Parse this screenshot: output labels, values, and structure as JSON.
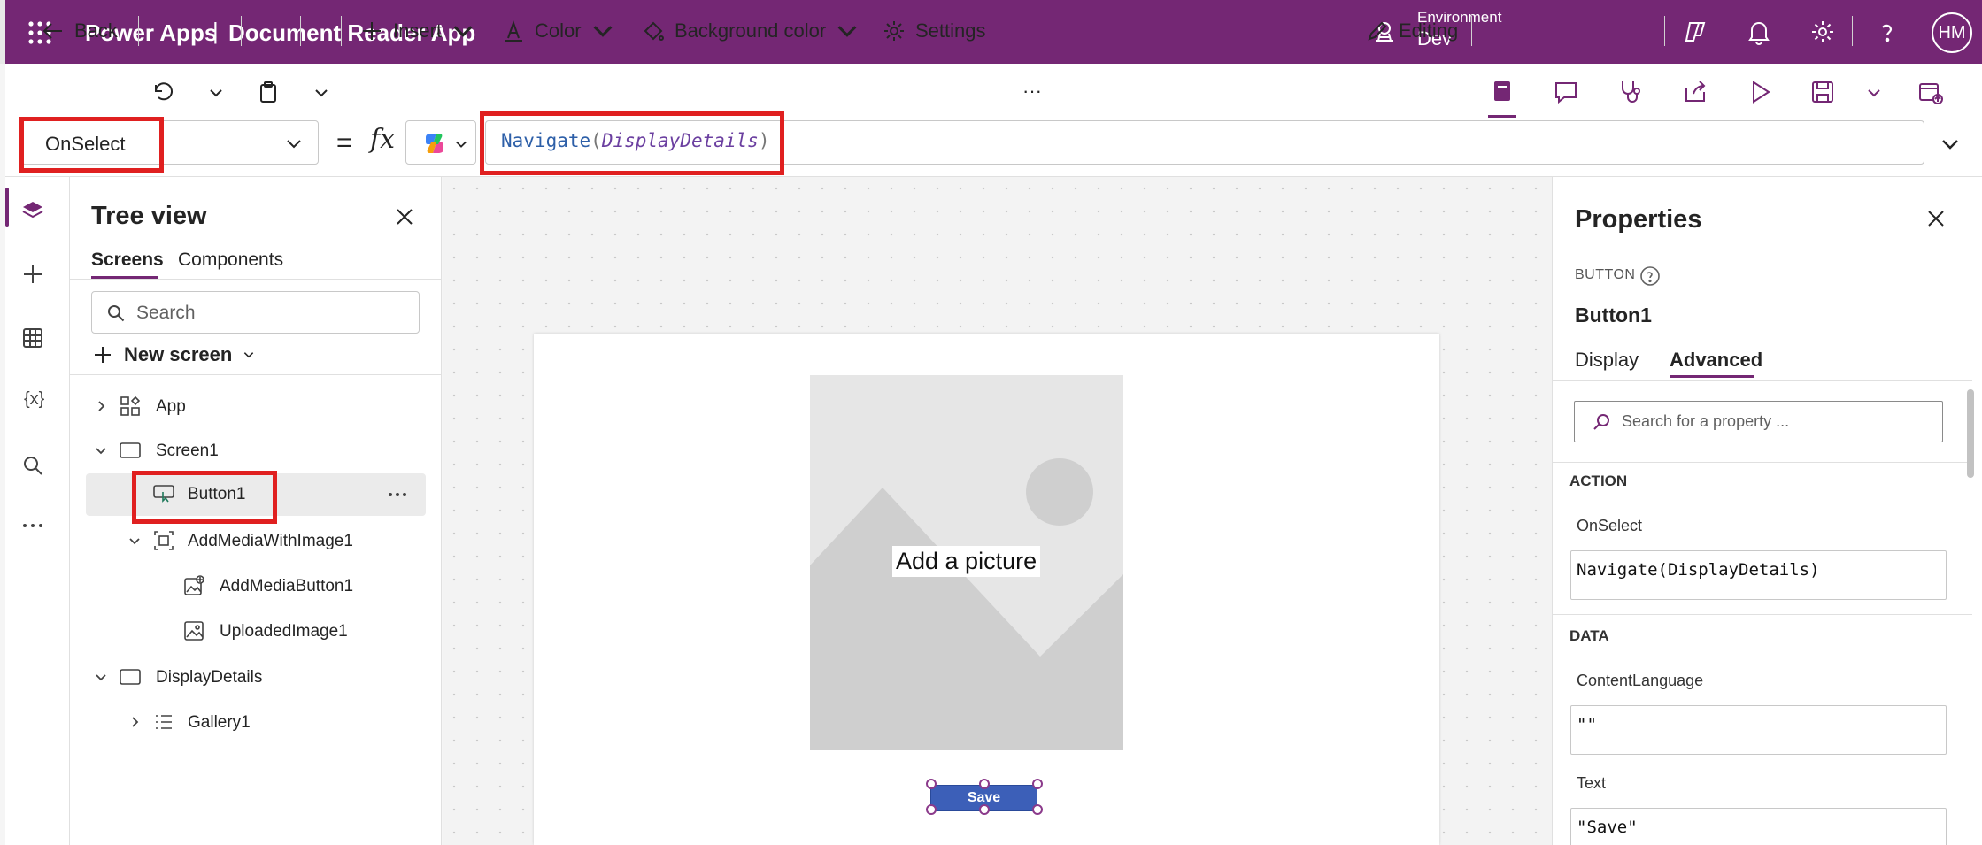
{
  "header": {
    "app_name": "Power Apps",
    "separator": "|",
    "document_name": "Document Reader App",
    "environment_label": "Environment",
    "environment_value": "Dev",
    "avatar_initials": "HM"
  },
  "toolbar": {
    "back": "Back",
    "insert": "Insert",
    "color": "Color",
    "background_color": "Background color",
    "settings": "Settings",
    "more": "···",
    "editing": "Editing"
  },
  "formula_bar": {
    "property": "OnSelect",
    "equals": "=",
    "fx": "fx",
    "formula_fn": "Navigate",
    "formula_open": "(",
    "formula_arg": "DisplayDetails",
    "formula_close": ")"
  },
  "tree_view": {
    "title": "Tree view",
    "tabs": [
      "Screens",
      "Components"
    ],
    "search_placeholder": "Search",
    "new_screen": "New screen",
    "nodes": [
      {
        "label": "App"
      },
      {
        "label": "Screen1"
      },
      {
        "label": "Button1"
      },
      {
        "label": "AddMediaWithImage1"
      },
      {
        "label": "AddMediaButton1"
      },
      {
        "label": "UploadedImage1"
      },
      {
        "label": "DisplayDetails"
      },
      {
        "label": "Gallery1"
      }
    ]
  },
  "canvas": {
    "placeholder_text": "Add a picture",
    "button_text": "Save"
  },
  "properties": {
    "title": "Properties",
    "control_type": "BUTTON",
    "control_name": "Button1",
    "tabs": [
      "Display",
      "Advanced"
    ],
    "search_placeholder": "Search for a property ...",
    "sections": [
      {
        "name": "ACTION",
        "props": [
          {
            "label": "OnSelect",
            "value": "Navigate(DisplayDetails)"
          }
        ]
      },
      {
        "name": "DATA",
        "props": [
          {
            "label": "ContentLanguage",
            "value": "\"\""
          },
          {
            "label": "Text",
            "value": "\"Save\""
          }
        ]
      }
    ]
  },
  "colors": {
    "brand": "#742774",
    "highlight": "#e02020",
    "button": "#3c5fb8"
  }
}
